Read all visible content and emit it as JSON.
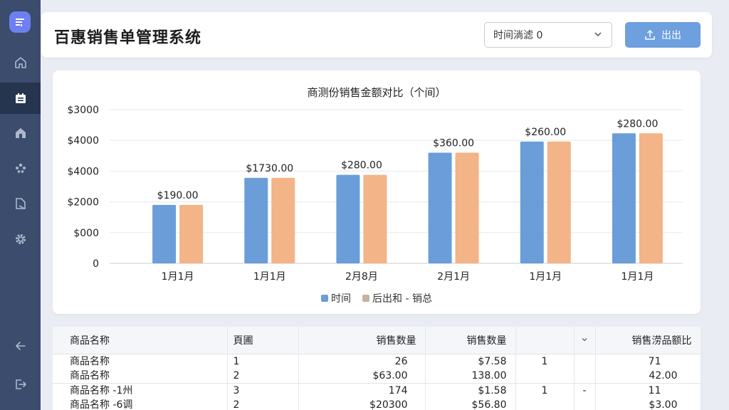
{
  "app": {
    "title": "百惠销售单管理系统"
  },
  "sidebar": {
    "items": [
      {
        "icon": "home-icon",
        "active": false
      },
      {
        "icon": "orders-icon",
        "active": true
      },
      {
        "icon": "store-icon",
        "active": false
      },
      {
        "icon": "team-icon",
        "active": false
      },
      {
        "icon": "report-icon",
        "active": false
      },
      {
        "icon": "gear-icon",
        "active": false
      }
    ],
    "bottom": [
      {
        "icon": "back-arrow-icon"
      },
      {
        "icon": "logout-icon"
      }
    ]
  },
  "header": {
    "time_select_value": "时间淌滤 0",
    "export_label": "出出"
  },
  "chart_data": {
    "type": "bar",
    "title": "商测份销售金额对比（个间）",
    "categories": [
      "1月1月",
      "1月1月",
      "2月8月",
      "2月1月",
      "1月1月",
      "1月1月"
    ],
    "series": [
      {
        "name": "时间",
        "color": "#6b9ed8",
        "values": [
          1900,
          2780,
          2880,
          3600,
          3960,
          4230
        ]
      },
      {
        "name": "后出和 - 销总",
        "color": "#f3b487",
        "values": [
          1900,
          2780,
          2880,
          3600,
          3960,
          4230
        ]
      }
    ],
    "value_labels": [
      "$190.00",
      "$1730.00",
      "$280.00",
      "$360.00",
      "$260.00",
      "$280.00"
    ],
    "y_tick_labels": [
      "0",
      "$000",
      "$2000",
      "$4000",
      "$4000",
      "$3000"
    ],
    "ylim": [
      0,
      5000
    ],
    "grid": true,
    "legend_position": "bottom-center"
  },
  "table": {
    "headers": [
      "商品名称",
      "頁圃",
      "销售数量",
      "销售数量",
      "",
      "",
      "销售涝品额比"
    ],
    "rows": [
      [
        "商品名称",
        "1",
        "26",
        "$7.58",
        "1",
        "",
        "71"
      ],
      [
        "商品名称",
        "2",
        "$63.00",
        "138.00",
        "",
        "",
        "42.00"
      ],
      [
        "商品名称 -1州",
        "3",
        "174",
        "$1.58",
        "1",
        "-",
        "11"
      ],
      [
        "商品名称 -6调",
        "2",
        "$20300",
        "$56.80",
        "",
        "",
        "$3.00"
      ]
    ]
  }
}
